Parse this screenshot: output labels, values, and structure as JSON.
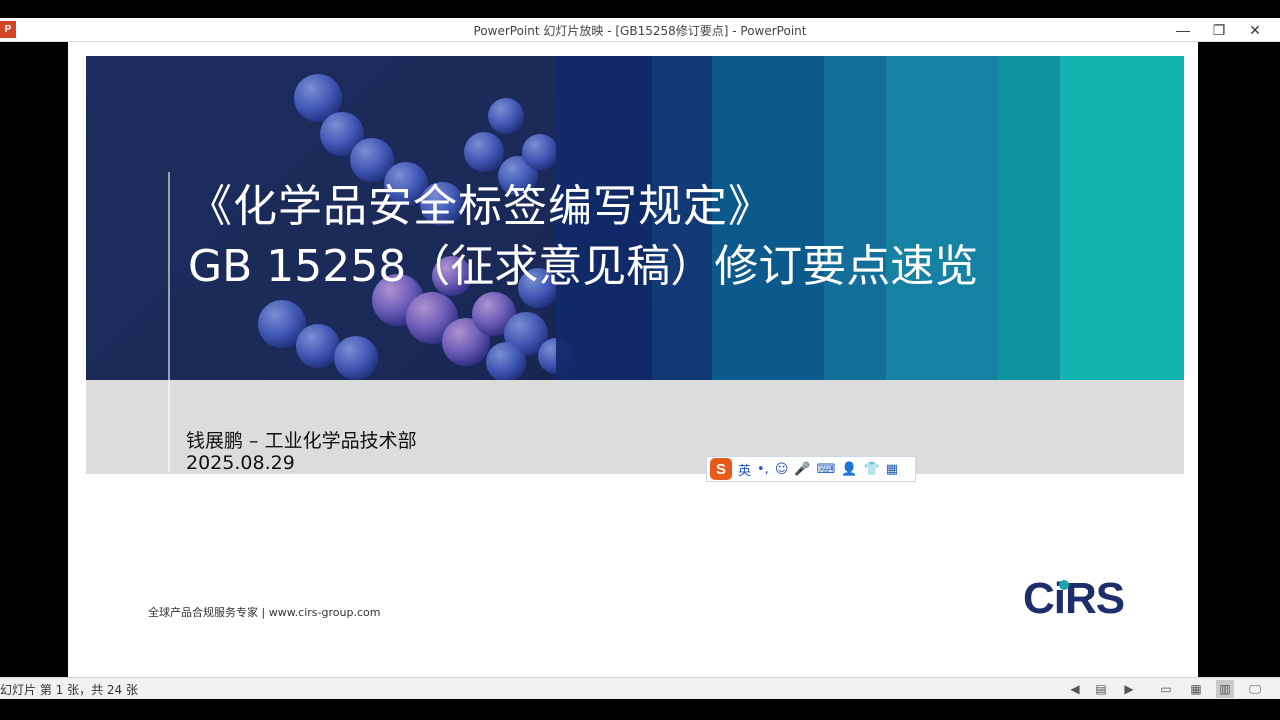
{
  "window": {
    "app_icon_letter": "P",
    "title": "PowerPoint 幻灯片放映 - [GB15258修订要点] - PowerPoint",
    "minimize_glyph": "—",
    "restore_glyph": "❐",
    "close_glyph": "✕"
  },
  "slide": {
    "title_line1": "《化学品安全标签编写规定》",
    "title_line2": "GB 15258（征求意见稿）修订要点速览",
    "author": "钱展鹏 – 工业化学品技术部",
    "date": "2025.08.29",
    "footer": "全球产品合规服务专家    |    www.cirs-group.com",
    "logo_text_1": "C",
    "logo_text_2": "RS",
    "logo_i": "i"
  },
  "ime": {
    "logo": "S",
    "mode": "英",
    "punct": "•,",
    "emoji_icon": "☺",
    "voice_icon": "🎤",
    "keyboard_icon": "⌨",
    "user_icon": "👤",
    "skin_icon": "👕",
    "toolbox_icon": "▦"
  },
  "statusbar": {
    "slide_count": "幻灯片 第 1 张，共 24 张",
    "prev_icon": "◀",
    "menu_icon": "▤",
    "next_icon": "▶",
    "normal_icon": "▭",
    "sorter_icon": "▦",
    "reading_icon": "▥",
    "slideshow_icon": "🖵"
  },
  "colors": {
    "banner_dark": "#1b2d5e",
    "teal": "#12b3b0",
    "logo_navy": "#1d2f6b",
    "ime_orange": "#e85a1c"
  }
}
